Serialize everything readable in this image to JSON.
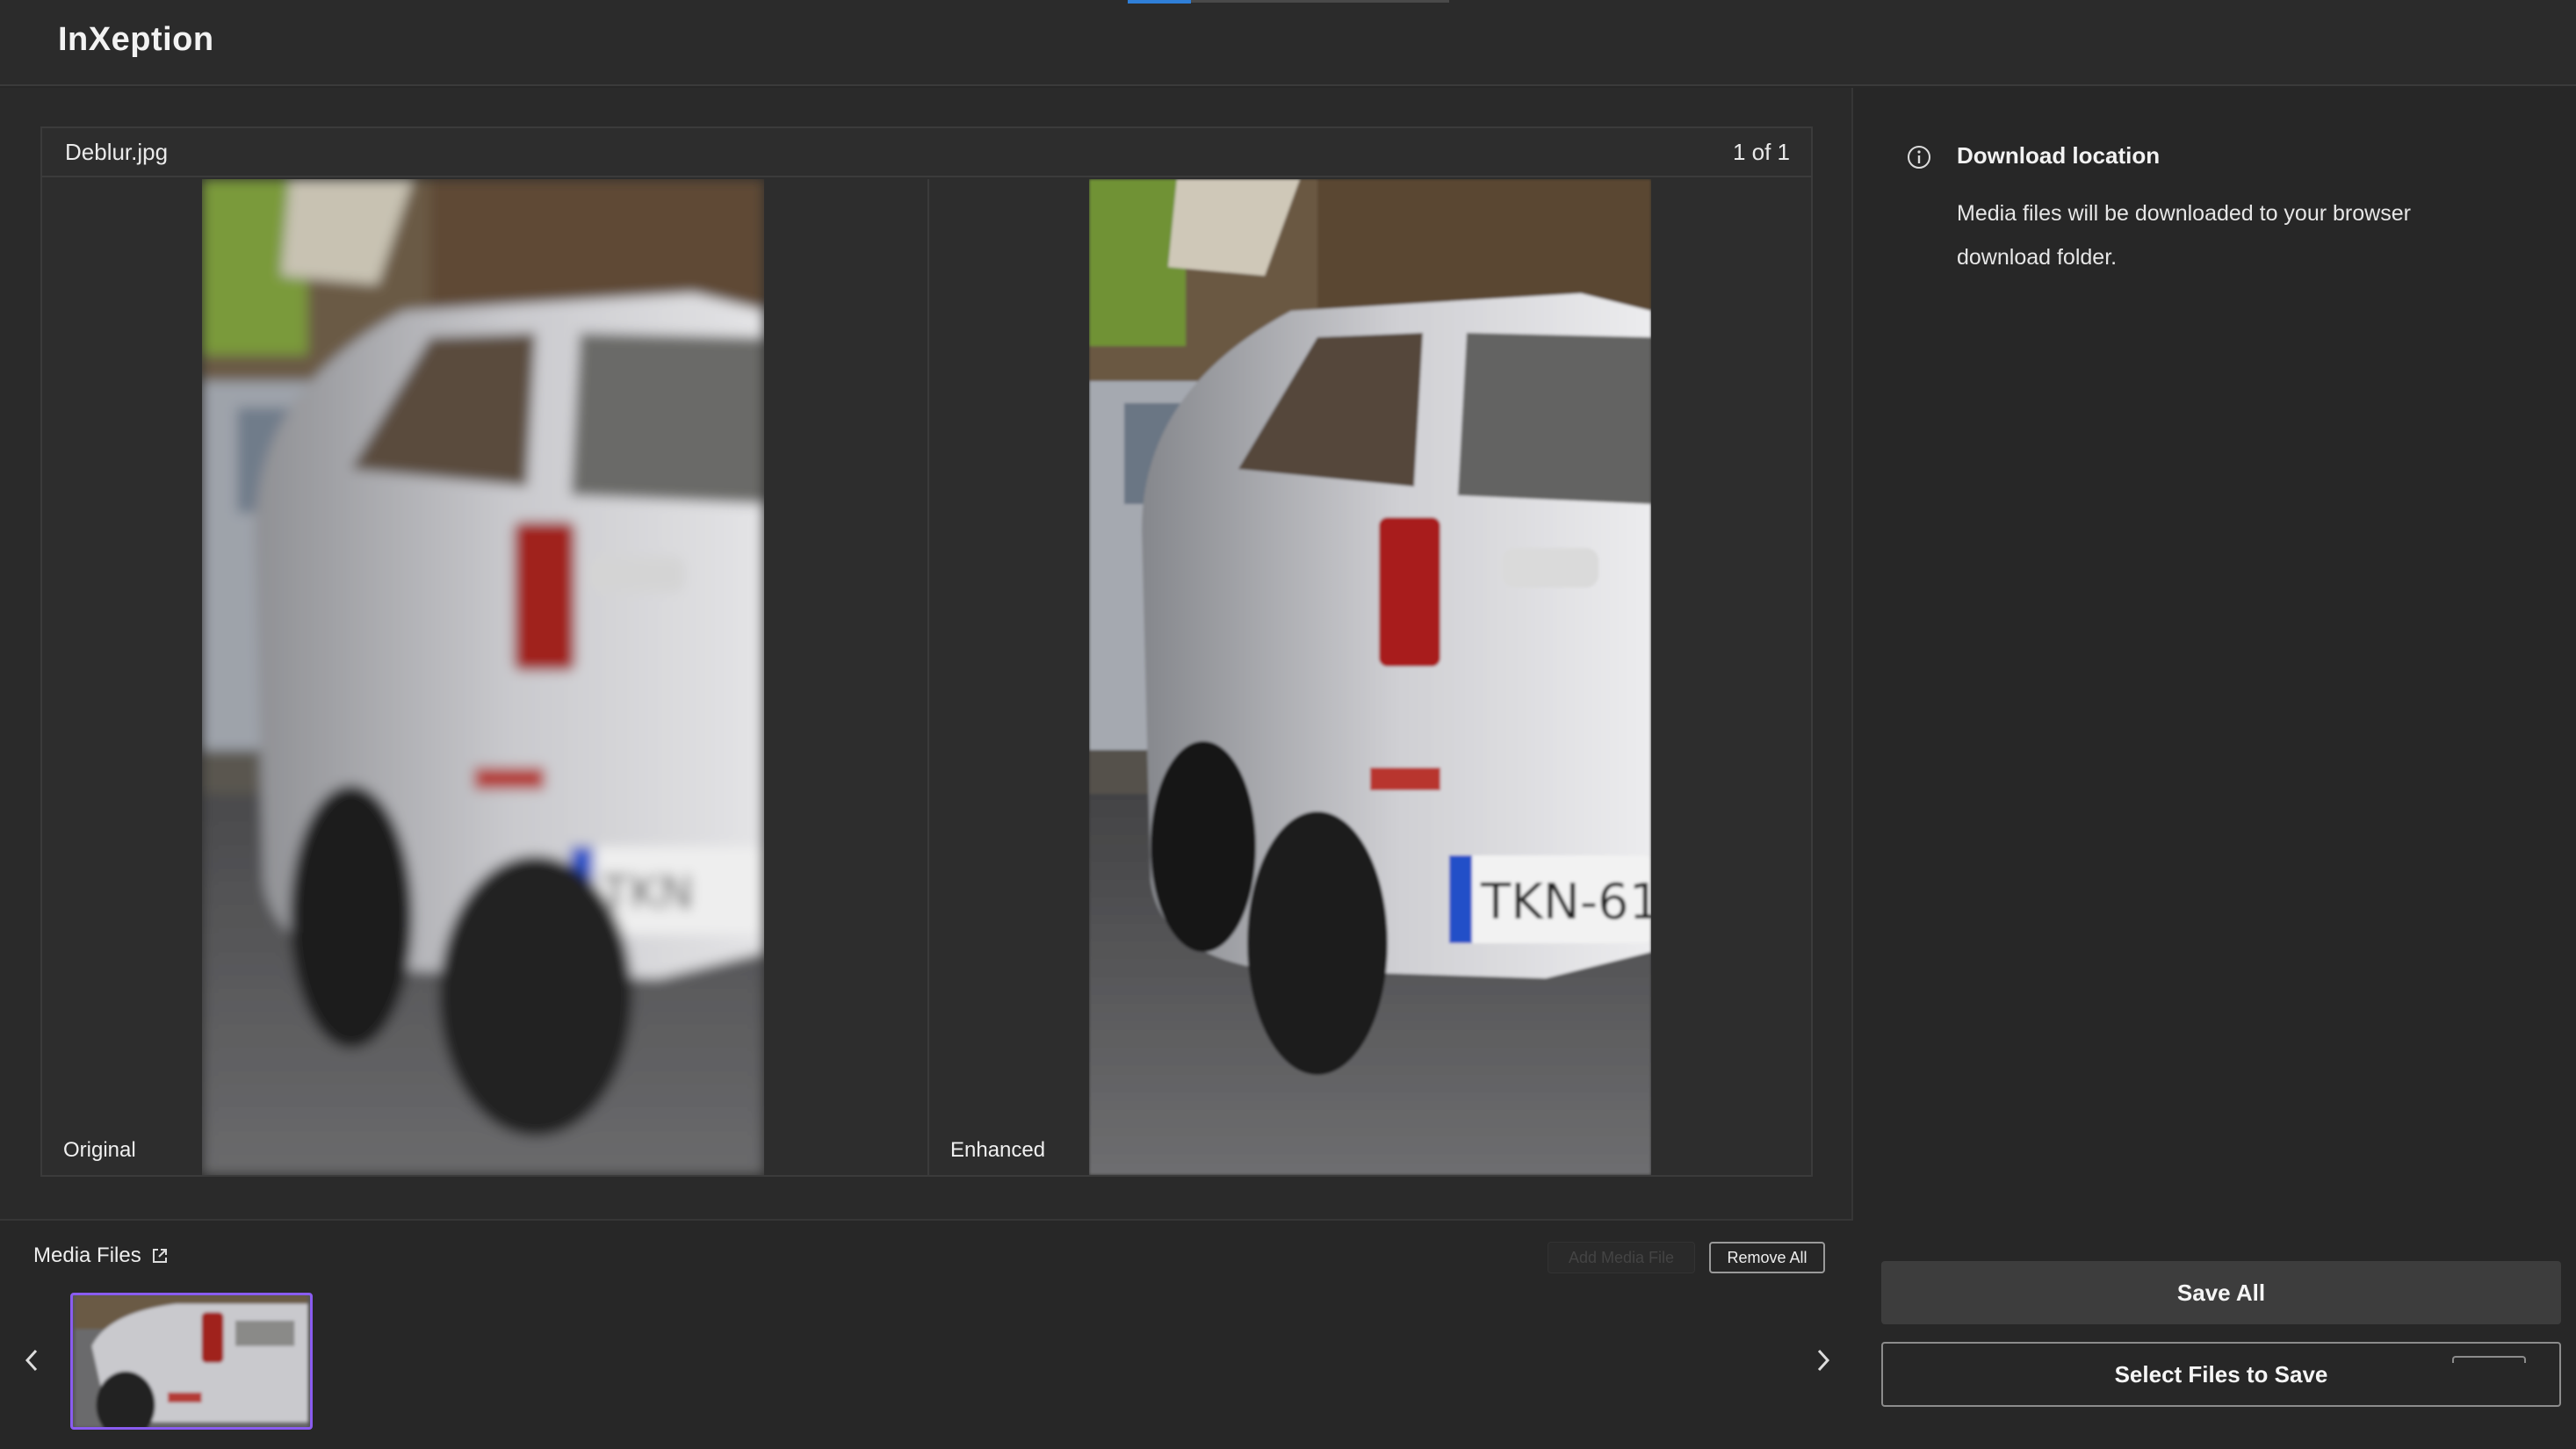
{
  "header": {
    "app_title": "InXeption"
  },
  "viewer": {
    "file_name": "Deblur.jpg",
    "counter": "1 of 1",
    "left_label": "Original",
    "right_label": "Enhanced",
    "original_plate_text": "TKN",
    "enhanced_plate_text": "TKN-61"
  },
  "media": {
    "title": "Media Files",
    "add_label": "Add Media File",
    "remove_all_label": "Remove All",
    "prev_icon": "chevron-left-icon",
    "next_icon": "chevron-right-icon"
  },
  "download": {
    "icon": "info-icon",
    "title": "Download location",
    "description": "Media files will be downloaded to your browser download folder."
  },
  "actions": {
    "save_all_label": "Save All",
    "select_files_label": "Select Files to Save"
  },
  "colors": {
    "accent_blue": "#2f7fd8",
    "thumb_selected": "#8a5cf0"
  }
}
